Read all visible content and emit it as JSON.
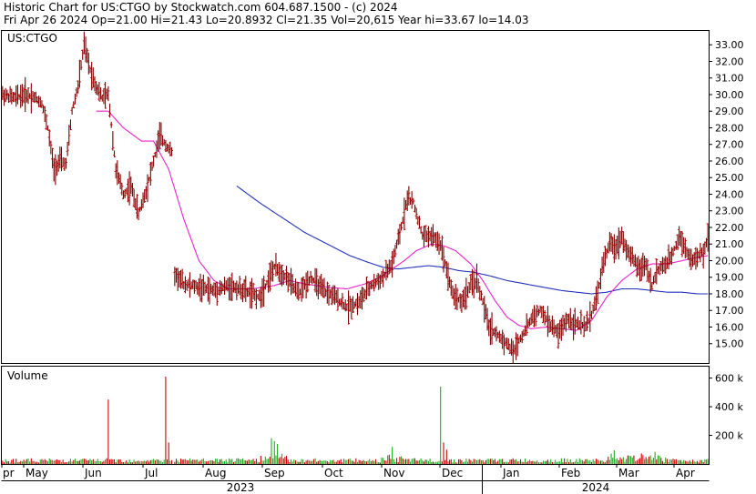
{
  "header": {
    "line1": "Historic Chart for US:CTGO by Stockwatch.com 604.687.1500 - (c) 2024",
    "line2": "Fri Apr 26 2024   Op=21.00  Hi=21.43  Lo=20.8932  Cl=21.35  Vol=20,615   Year hi=33.67  lo=14.03"
  },
  "chart_data": [
    {
      "type": "bar",
      "subtype": "ohlc",
      "title": "",
      "symbol_label": "US:CTGO",
      "x_months": [
        "pr",
        "May",
        "Jun",
        "Jul",
        "Aug",
        "Sep",
        "Oct",
        "Nov",
        "Dec",
        "Jan",
        "Feb",
        "Mar",
        "Apr"
      ],
      "x_years": [
        "2023",
        "2024"
      ],
      "ylim": [
        14,
        33.67
      ],
      "y_ticks": [
        "15.00",
        "16.00",
        "17.00",
        "18.00",
        "19.00",
        "20.00",
        "21.00",
        "22.00",
        "23.00",
        "24.00",
        "25.00",
        "26.00",
        "27.00",
        "28.00",
        "29.00",
        "30.00",
        "31.00",
        "32.00",
        "33.00"
      ],
      "grid": false,
      "colors": {
        "bar": "#7a0000",
        "tick": "#cc0000",
        "ma_short": "#ee22cc",
        "ma_long": "#2233bb"
      },
      "price_anchors": [
        [
          0,
          30.0
        ],
        [
          8,
          29.8
        ],
        [
          14,
          30.0
        ],
        [
          20,
          29.9
        ],
        [
          26,
          29.5
        ],
        [
          30,
          28.0
        ],
        [
          34,
          25.5
        ],
        [
          38,
          26.0
        ],
        [
          42,
          25.8
        ],
        [
          46,
          29.0
        ],
        [
          50,
          30.5
        ],
        [
          54,
          33.0
        ],
        [
          58,
          31.5
        ],
        [
          62,
          30.5
        ],
        [
          66,
          29.8
        ],
        [
          70,
          30.0
        ],
        [
          75,
          25.5
        ],
        [
          80,
          24.0
        ],
        [
          85,
          24.5
        ],
        [
          90,
          22.8
        ],
        [
          95,
          24.2
        ],
        [
          100,
          26.0
        ],
        [
          104,
          27.5
        ],
        [
          108,
          27.0
        ],
        [
          112,
          26.5
        ],
        [
          114,
          19.2
        ],
        [
          120,
          18.6
        ],
        [
          130,
          18.4
        ],
        [
          140,
          18.2
        ],
        [
          150,
          18.5
        ],
        [
          160,
          18.2
        ],
        [
          170,
          17.8
        ],
        [
          180,
          19.6
        ],
        [
          188,
          19.0
        ],
        [
          196,
          18.0
        ],
        [
          204,
          19.0
        ],
        [
          212,
          18.2
        ],
        [
          220,
          17.8
        ],
        [
          228,
          17.2
        ],
        [
          236,
          17.5
        ],
        [
          244,
          18.5
        ],
        [
          252,
          19.0
        ],
        [
          258,
          19.8
        ],
        [
          264,
          22.0
        ],
        [
          268,
          23.8
        ],
        [
          272,
          23.5
        ],
        [
          278,
          21.5
        ],
        [
          284,
          21.5
        ],
        [
          290,
          21.0
        ],
        [
          294,
          19.5
        ],
        [
          298,
          18.0
        ],
        [
          304,
          17.5
        ],
        [
          310,
          18.5
        ],
        [
          314,
          18.8
        ],
        [
          318,
          17.5
        ],
        [
          322,
          16.0
        ],
        [
          328,
          15.5
        ],
        [
          334,
          15.0
        ],
        [
          338,
          14.5
        ],
        [
          342,
          15.2
        ],
        [
          346,
          15.8
        ],
        [
          350,
          16.5
        ],
        [
          356,
          17.0
        ],
        [
          362,
          16.2
        ],
        [
          368,
          15.6
        ],
        [
          374,
          16.5
        ],
        [
          380,
          16.2
        ],
        [
          386,
          16.0
        ],
        [
          390,
          16.8
        ],
        [
          394,
          18.0
        ],
        [
          398,
          20.0
        ],
        [
          402,
          21.0
        ],
        [
          406,
          20.8
        ],
        [
          410,
          21.5
        ],
        [
          414,
          20.5
        ],
        [
          418,
          20.0
        ],
        [
          422,
          19.5
        ],
        [
          426,
          19.8
        ],
        [
          430,
          18.5
        ],
        [
          434,
          19.5
        ],
        [
          440,
          19.8
        ],
        [
          444,
          20.5
        ],
        [
          448,
          21.5
        ],
        [
          452,
          20.8
        ],
        [
          456,
          20.0
        ],
        [
          460,
          20.2
        ],
        [
          464,
          20.5
        ],
        [
          467,
          21.35
        ]
      ],
      "ma_short_anchors": [
        [
          62,
          29.0
        ],
        [
          70,
          29.0
        ],
        [
          80,
          28.0
        ],
        [
          92,
          27.2
        ],
        [
          100,
          27.2
        ],
        [
          110,
          25.5
        ],
        [
          120,
          22.5
        ],
        [
          130,
          20.0
        ],
        [
          140,
          18.8
        ],
        [
          150,
          18.3
        ],
        [
          165,
          18.3
        ],
        [
          180,
          18.5
        ],
        [
          190,
          18.8
        ],
        [
          200,
          18.6
        ],
        [
          215,
          18.4
        ],
        [
          228,
          18.3
        ],
        [
          240,
          18.6
        ],
        [
          250,
          19.0
        ],
        [
          258,
          19.5
        ],
        [
          266,
          20.0
        ],
        [
          274,
          20.6
        ],
        [
          284,
          21.0
        ],
        [
          292,
          20.9
        ],
        [
          300,
          20.6
        ],
        [
          310,
          19.8
        ],
        [
          318,
          18.8
        ],
        [
          326,
          17.6
        ],
        [
          334,
          16.6
        ],
        [
          342,
          16.1
        ],
        [
          350,
          15.9
        ],
        [
          360,
          16.0
        ],
        [
          370,
          15.9
        ],
        [
          380,
          15.8
        ],
        [
          390,
          16.4
        ],
        [
          400,
          17.8
        ],
        [
          410,
          18.8
        ],
        [
          420,
          19.5
        ],
        [
          430,
          19.8
        ],
        [
          440,
          19.8
        ],
        [
          450,
          20.0
        ],
        [
          460,
          20.2
        ],
        [
          467,
          20.3
        ]
      ],
      "ma_long_anchors": [
        [
          155,
          24.5
        ],
        [
          170,
          23.5
        ],
        [
          185,
          22.6
        ],
        [
          200,
          21.7
        ],
        [
          215,
          21.0
        ],
        [
          230,
          20.3
        ],
        [
          242,
          19.9
        ],
        [
          252,
          19.6
        ],
        [
          262,
          19.5
        ],
        [
          272,
          19.6
        ],
        [
          282,
          19.7
        ],
        [
          292,
          19.6
        ],
        [
          302,
          19.4
        ],
        [
          312,
          19.3
        ],
        [
          322,
          19.1
        ],
        [
          334,
          18.8
        ],
        [
          346,
          18.6
        ],
        [
          358,
          18.4
        ],
        [
          370,
          18.2
        ],
        [
          380,
          18.1
        ],
        [
          390,
          18.0
        ],
        [
          400,
          18.1
        ],
        [
          410,
          18.3
        ],
        [
          420,
          18.3
        ],
        [
          430,
          18.2
        ],
        [
          440,
          18.1
        ],
        [
          450,
          18.1
        ],
        [
          460,
          18.0
        ],
        [
          467,
          18.0
        ]
      ]
    },
    {
      "type": "bar",
      "title": "Volume",
      "unit": "k",
      "ylim": [
        0,
        680
      ],
      "y_ticks": [
        "200 k",
        "400 k",
        "600 k"
      ],
      "colors": {
        "down": "#cc0000",
        "up": "#22aa22"
      },
      "spikes": [
        {
          "i": 70,
          "v": 450,
          "up": false
        },
        {
          "i": 108,
          "v": 610,
          "up": false
        },
        {
          "i": 110,
          "v": 150,
          "up": false
        },
        {
          "i": 178,
          "v": 180,
          "up": true
        },
        {
          "i": 180,
          "v": 160,
          "up": true
        },
        {
          "i": 182,
          "v": 140,
          "up": true
        },
        {
          "i": 258,
          "v": 120,
          "up": true
        },
        {
          "i": 290,
          "v": 540,
          "up": true
        },
        {
          "i": 292,
          "v": 150,
          "up": false
        },
        {
          "i": 294,
          "v": 100,
          "up": false
        },
        {
          "i": 405,
          "v": 95,
          "up": true
        },
        {
          "i": 432,
          "v": 85,
          "up": true
        }
      ]
    }
  ]
}
